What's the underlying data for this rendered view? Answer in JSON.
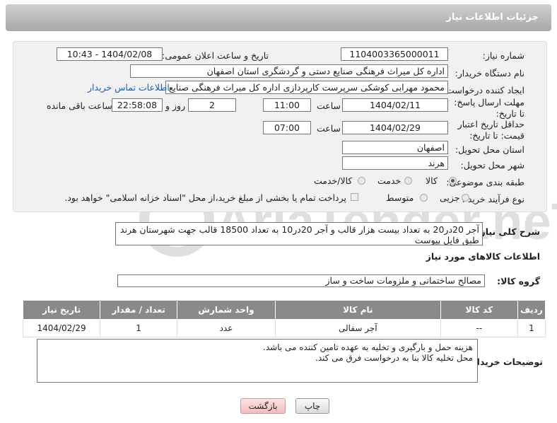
{
  "header": {
    "title": "جزئیات اطلاعات نیاز"
  },
  "form": {
    "need_number_label": "شماره نیاز:",
    "need_number": "1104003365000011",
    "announce_label": "تاریخ و ساعت اعلان عمومی:",
    "announce_value": "1404/02/08 - 10:43",
    "buyer_label": "نام دستگاه خریدار:",
    "buyer_value": "اداره کل میراث فرهنگی  صنایع دستی و گردشگری استان اصفهان",
    "creator_label": "ایجاد کننده درخواست:",
    "creator_value": "محمود مهرابی کوشکی سرپرست کارپردازی اداره کل میراث فرهنگی  صنایع دس",
    "contact_link": "اطلاعات تماس خریدار",
    "reply_label": "مهلت ارسال پاسخ: تا تاریخ:",
    "reply_date": "1404/02/11",
    "time_label": "ساعت",
    "reply_time": "11:00",
    "days_value": "2",
    "days_label": "روز و",
    "remaining_time": "22:58:08",
    "remaining_label": "ساعت باقی مانده",
    "validity_label": "حداقل تاریخ اعتبار قیمت: تا تاریخ:",
    "validity_date": "1404/02/29",
    "validity_time": "07:00",
    "province_label": "استان محل تحویل:",
    "province_value": "اصفهان",
    "city_label": "شهر محل تحویل:",
    "city_value": "هرند",
    "category_label": "طبقه بندی موضوعی:",
    "category_options": [
      "کالا",
      "خدمت",
      "کالا/خدمت"
    ],
    "category_selected": "کالا",
    "process_label": "نوع فرآیند خرید :",
    "process_options": [
      "جزیی",
      "متوسط"
    ],
    "process_selected": "",
    "payment_note": "پرداخت تمام یا بخشی از مبلغ خرید،از محل \"اسناد خزانه اسلامی\" خواهد بود."
  },
  "description": {
    "label": "شرح کلی نیاز:",
    "text": "آجر 20در20 به تعداد بیست هزار قالب و آجر 20در10 به تعداد 18500 قالب جهت شهرستان هرند طبق فایل پیوست"
  },
  "goods_info": {
    "section_title": "اطلاعات کالاهای مورد نیاز",
    "group_label": "گروه کالا:",
    "group_value": "مصالح ساختمانی و ملزومات ساخت و ساز",
    "columns": [
      "ردیف",
      "کد کالا",
      "نام کالا",
      "واحد شمارش",
      "تعداد / مقدار",
      "تاریخ نیاز"
    ],
    "rows": [
      {
        "row": "1",
        "code": "--",
        "name": "آجر سفالی",
        "unit": "عدد",
        "qty": "1",
        "date": "1404/02/29"
      }
    ]
  },
  "buyer_notes": {
    "label": "توضیحات خریدار:",
    "line1": "هزینه حمل و بارگیری و تخلیه به عهده تامین کننده می باشد.",
    "line2": "محل تخلیه کالا بنا به درخواست فرق می کند."
  },
  "buttons": {
    "print": "چاپ",
    "back": "بازگشت"
  },
  "watermark": "AriaTender.neT"
}
